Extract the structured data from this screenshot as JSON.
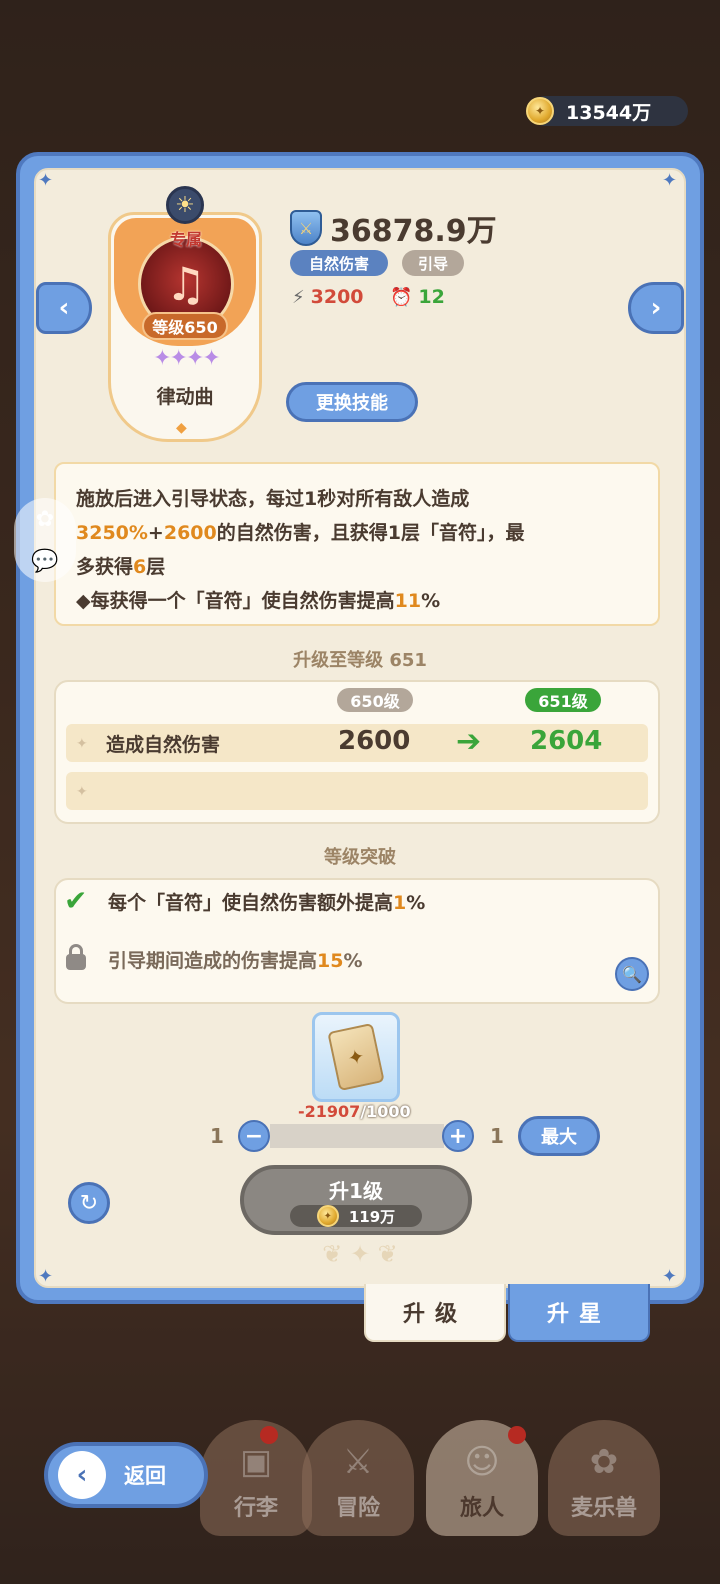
{
  "currency": {
    "amount": "13544万",
    "icon": "gold-coin-icon"
  },
  "skill": {
    "exclusive_label": "专属",
    "level_badge": "等级650",
    "stars": "✦✦✦✦",
    "star_count": 4,
    "name": "律动曲",
    "icon": "harp-icon"
  },
  "stats": {
    "power": "36878.9万",
    "tags": [
      "自然伤害",
      "引导"
    ],
    "energy": "3200",
    "cooldown": "12"
  },
  "buttons": {
    "change_skill": "更换技能",
    "max": "最大",
    "upgrade_label": "升1级",
    "upgrade_cost": "119万",
    "back": "返回"
  },
  "description": {
    "part1": "施放后进入引导状态，每过1秒对所有敌人造成",
    "part2_a": "3250%",
    "part2_b": "+",
    "part2_c": "2600",
    "part2_d": "的自然伤害，且获得1层「音符」，最",
    "part3_a": "多获得",
    "part3_b": "6",
    "part3_c": "层",
    "part4_a": "◆每获得一个「音符」使自然伤害提高",
    "part4_b": "11",
    "part4_c": "%"
  },
  "upgrade": {
    "title": "升级至等级 651",
    "current_level": "650级",
    "next_level": "651级",
    "row_label": "造成自然伤害",
    "current_value": "2600",
    "next_value": "2604"
  },
  "breakthrough": {
    "title": "等级突破",
    "line1_a": "每个「音符」使自然伤害额外提高",
    "line1_b": "1",
    "line1_c": "%",
    "line2_a": "引导期间造成的伤害提高",
    "line2_b": "15",
    "line2_c": "%"
  },
  "material": {
    "owned": "-21907",
    "required": "/1000",
    "qty_min": "1",
    "qty_max": "1"
  },
  "tabs": {
    "level_up": "升级",
    "star_up": "升星"
  },
  "nav": [
    "行李",
    "冒险",
    "旅人",
    "麦乐兽"
  ],
  "colors": {
    "accent_blue": "#6f9fe2",
    "green": "#3aa53a",
    "orange": "#e0891e",
    "red": "#d24a3a"
  }
}
